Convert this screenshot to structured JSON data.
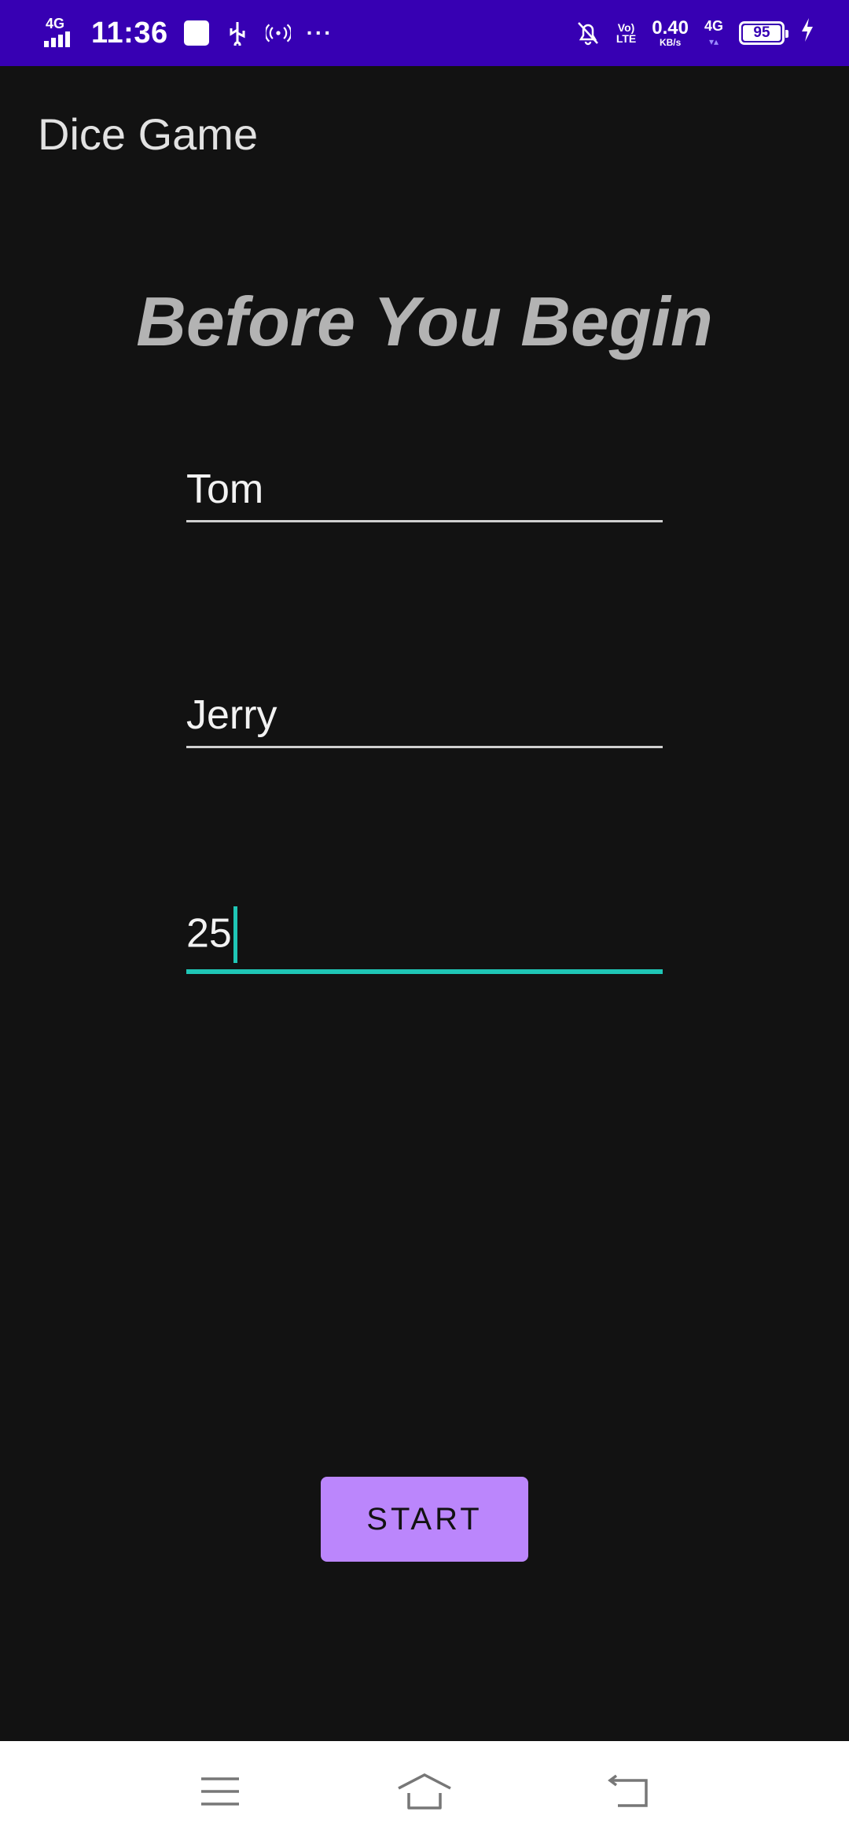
{
  "status_bar": {
    "network": "4G",
    "time": "11:36",
    "volte_line1": "Vo)",
    "volte_line2": "LTE",
    "speed_value": "0.40",
    "speed_unit": "KB/s",
    "network_right": "4G",
    "battery": "95"
  },
  "app_bar": {
    "title": "Dice Game"
  },
  "heading": "Before You Begin",
  "form": {
    "player1": "Tom",
    "player2": "Jerry",
    "target_score": "25"
  },
  "start_button": "START",
  "colors": {
    "status_bar_bg": "#3700B3",
    "background": "#121212",
    "accent": "#1FC6B6",
    "button": "#BB86FC"
  },
  "icons": [
    "menu-icon",
    "home-icon",
    "back-icon"
  ]
}
